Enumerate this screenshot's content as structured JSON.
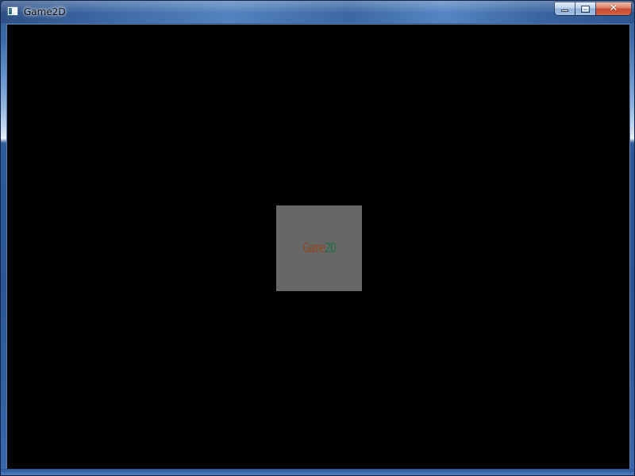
{
  "window": {
    "title": "Game2D",
    "controls": {
      "minimize_icon": "minimize-icon",
      "maximize_icon": "maximize-icon",
      "close_glyph": "✕"
    }
  },
  "canvas": {
    "background": "#000000",
    "splash": {
      "background": "#676767",
      "logo_part1": "Game",
      "logo_part2": "2D",
      "logo_part1_color": "#8b4a28",
      "logo_part2_color": "#1f6f49"
    }
  }
}
